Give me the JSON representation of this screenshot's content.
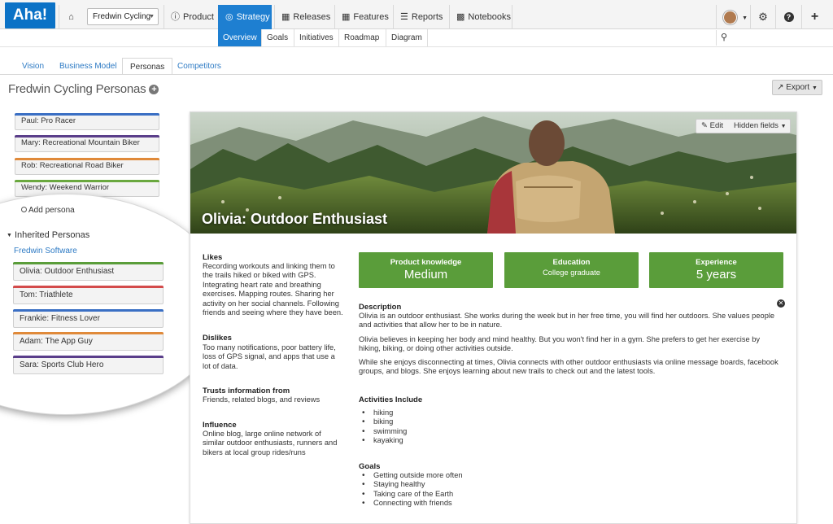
{
  "header": {
    "logo": "Aha!",
    "workspace": "Fredwin Cycling",
    "nav": [
      "Product",
      "Strategy",
      "Releases",
      "Features",
      "Reports",
      "Notebooks"
    ],
    "active_nav": "Strategy",
    "subnav": [
      "Overview",
      "Goals",
      "Initiatives",
      "Roadmap",
      "Diagram"
    ],
    "active_subnav": "Overview"
  },
  "tabs": [
    "Vision",
    "Business Model",
    "Personas",
    "Competitors"
  ],
  "active_tab": "Personas",
  "page_title": "Fredwin Cycling Personas",
  "export_label": "Export",
  "personas": [
    {
      "label": "Paul: Pro Racer",
      "color": "#3a6fc4"
    },
    {
      "label": "Mary: Recreational Mountain Biker",
      "color": "#5a3e8a"
    },
    {
      "label": "Rob: Recreational Road Biker",
      "color": "#e08a3a"
    },
    {
      "label": "Wendy: Weekend Warrior",
      "color": "#6aa83f"
    }
  ],
  "add_persona": "Add persona",
  "inherited": {
    "heading": "Inherited Personas",
    "source": "Fredwin Software",
    "items": [
      {
        "label": "Olivia: Outdoor Enthusiast",
        "color": "#5a9d3a"
      },
      {
        "label": "Tom: Triathlete",
        "color": "#d34b4b"
      },
      {
        "label": "Frankie: Fitness Lover",
        "color": "#3a6fc4"
      },
      {
        "label": "Adam: The App Guy",
        "color": "#e08a3a"
      },
      {
        "label": "Sara: Sports Club Hero",
        "color": "#5a3e8a"
      }
    ]
  },
  "persona_detail": {
    "name": "Olivia: Outdoor Enthusiast",
    "edit_label": "Edit",
    "hidden_fields_label": "Hidden fields",
    "likes_label": "Likes",
    "likes": "Recording workouts and linking them to the trails hiked or biked with GPS. Integrating heart rate and breathing exercises. Mapping routes. Sharing her activity on her social channels. Following friends and seeing where they have been.",
    "dislikes_label": "Dislikes",
    "dislikes": "Too many notifications, poor battery life, loss of GPS signal, and apps that use a lot of data.",
    "trusts_label": "Trusts information from",
    "trusts": "Friends, related blogs, and reviews",
    "influence_label": "Influence",
    "influence": "Online blog, large online network of similar outdoor enthusiasts, runners and bikers at local group rides/runs",
    "stats": [
      {
        "title": "Product knowledge",
        "value": "Medium"
      },
      {
        "title": "Education",
        "value": "College graduate"
      },
      {
        "title": "Experience",
        "value": "5 years"
      }
    ],
    "description_label": "Description",
    "description": [
      "Olivia is an outdoor enthusiast. She works during the week but in her free time, you will find her outdoors. She values people and activities that allow her to be in nature.",
      "Olivia believes in keeping her body and mind healthy. But you won't find her in a gym. She prefers to get her exercise by hiking, biking, or doing other activities outside.",
      "While she enjoys disconnecting at times, Olivia connects with other outdoor enthusiasts via online message boards, facebook groups, and blogs. She enjoys learning about new trails to check out and the latest tools."
    ],
    "activities_label": "Activities Include",
    "activities": [
      "hiking",
      "biking",
      "swimming",
      "kayaking"
    ],
    "goals_label": "Goals",
    "goals": [
      "Getting outside more often",
      "Staying healthy",
      "Taking care of the Earth",
      "Connecting with friends"
    ]
  },
  "colors": {
    "accent": "#1e7fd1",
    "stat_green": "#5a9d3a"
  }
}
